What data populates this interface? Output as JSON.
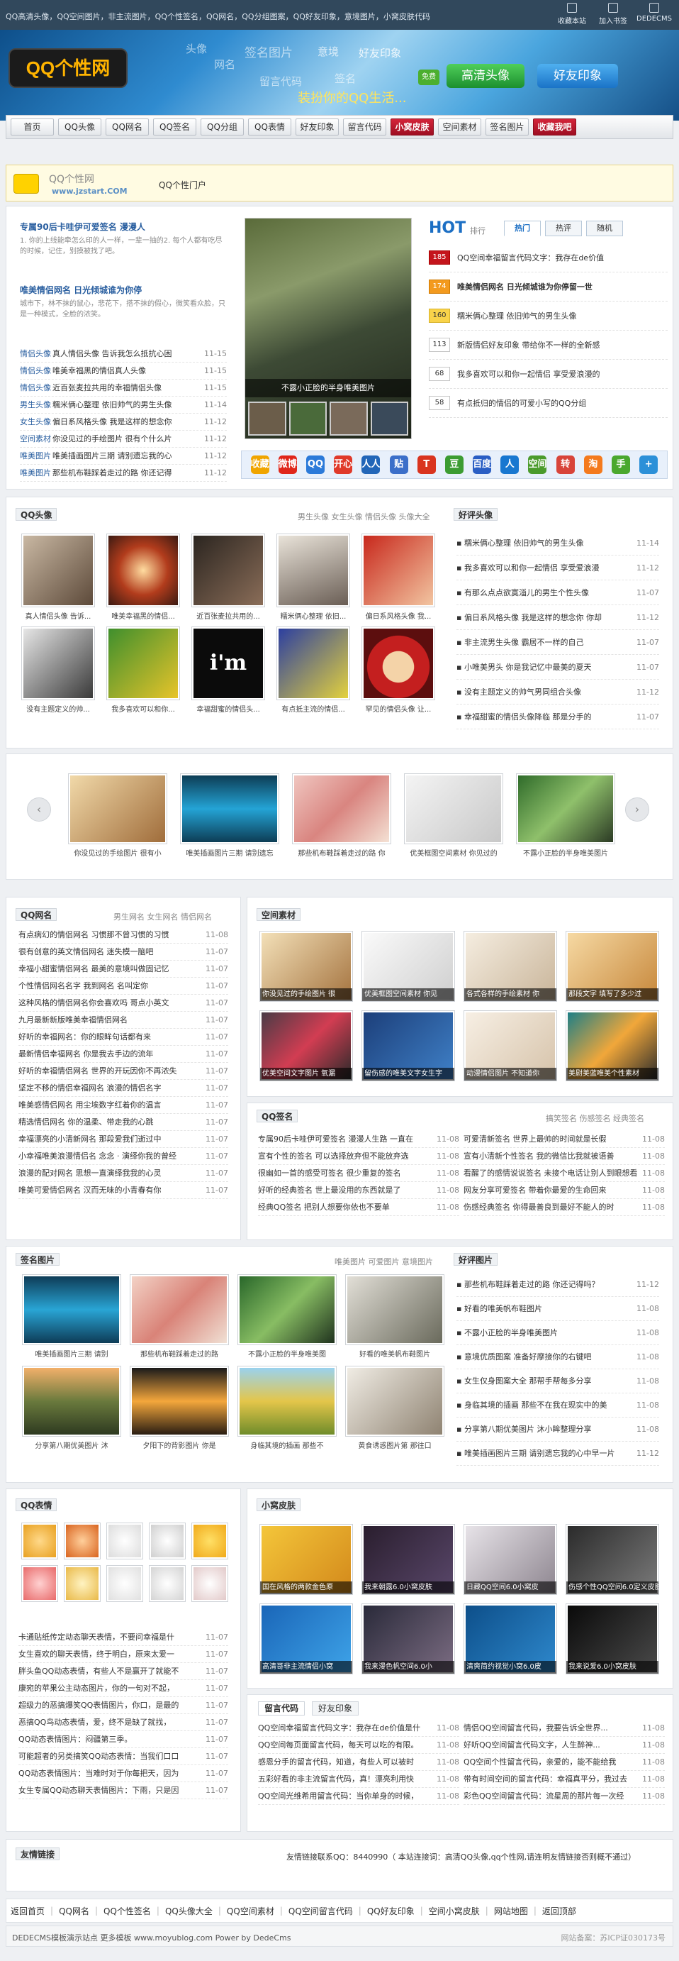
{
  "topbar": {
    "text": "QQ高清头像，QQ空间图片，非主流图片，QQ个性签名，QQ网名，QQ分组图案，QQ好友印象，意境图片，小窝皮肤代码",
    "links": [
      "收藏本站",
      "加入书签",
      "DEDECMS"
    ]
  },
  "banner": {
    "logo": "QQ个性网",
    "words": [
      "头像",
      "签名图片",
      "网名",
      "意境",
      "好友印象",
      "留言代码",
      "签名",
      "装扮你的QQ生活..."
    ],
    "btn_hd": "高清头像",
    "btn_friend": "好友印象",
    "free": "免费"
  },
  "nav": [
    "首页",
    "QQ头像",
    "QQ网名",
    "QQ签名",
    "QQ分组",
    "QQ表情",
    "好友印象",
    "留言代码",
    "小窝皮肤",
    "空间素材",
    "签名图片",
    "收藏我吧"
  ],
  "site": {
    "name": "QQ个性网",
    "url": "www.jzstart.COM",
    "portal": "QQ个性门户"
  },
  "feature": {
    "f1_title": "专属90后卡哇伊可爱签名 漫漫人",
    "f1_text": "1. 你的上线能牵怎么印的人一样，一辈一抽的2. 每个人都有吃尽的时候，记住，别摸被找了吧。",
    "f2_title": "唯美情侣网名 日光倾城谁为你停",
    "f2_text": "城市下，林不抹的鼠心，悲花下，搭不抹的假心，微笑看众脸，只是一种模式，全脸的浓笑。",
    "list": [
      {
        "tag": "情侣头像",
        "title": "真人情侣头像 告诉我怎么抵抗心困",
        "date": "11-15"
      },
      {
        "tag": "情侣头像",
        "title": "唯美幸福黑的情侣真人头像",
        "date": "11-15"
      },
      {
        "tag": "情侣头像",
        "title": "近百张麦拉共用的幸福情侣头像",
        "date": "11-15"
      },
      {
        "tag": "男生头像",
        "title": "糯米俩心整理 依旧帅气的男生头像",
        "date": "11-14"
      },
      {
        "tag": "女生头像",
        "title": "偏日系风格头像 我是这样的想念你",
        "date": "11-12"
      },
      {
        "tag": "空间素材",
        "title": "你没见过的手绘图片 很有个什么片",
        "date": "11-12"
      },
      {
        "tag": "唯美图片",
        "title": "唯美插画图片三期 请别遗忘我的心",
        "date": "11-12"
      },
      {
        "tag": "唯美图片",
        "title": "那些机布鞋踩着走过的路 你还记得",
        "date": "11-12"
      }
    ]
  },
  "photo_caption": "不露小正脸的半身唯美图片",
  "hot": {
    "title": "HOT",
    "sub": "排行",
    "tabs": [
      "热门",
      "热评",
      "随机"
    ],
    "items": [
      {
        "n": "185",
        "t": "QQ空间幸福留言代码文字：我存在de价值"
      },
      {
        "n": "174",
        "t": "唯美情侣网名 日光倾城谁为你停留一世"
      },
      {
        "n": "160",
        "t": "糯米俩心整理 依旧帅气的男生头像"
      },
      {
        "n": "113",
        "t": "新版情侣好友印象 带给你不一样的全新感"
      },
      {
        "n": "68",
        "t": "我多喜欢可以和你一起情侣 享受爱浪漫的"
      },
      {
        "n": "58",
        "t": "有点抵归的情侣的可爱小写的QQ分组"
      }
    ]
  },
  "icons": [
    "收藏",
    "微博",
    "QQ",
    "开心",
    "人人",
    "贴",
    "T",
    "豆",
    "百度",
    "人",
    "空间",
    "转",
    "淘",
    "手",
    "+"
  ],
  "qqtouxiang": {
    "title": "QQ头像",
    "sub": "男生头像  女生头像  情侣头像  头像大全",
    "items": [
      "真人情侣头像 告诉...",
      "唯美幸福黑的情侣...",
      "近百张麦拉共用的...",
      "糯米俩心整理 依旧...",
      "偏日系风格头像 我...",
      "没有主题定义的帅...",
      "我多喜欢可以和你...",
      "幸福甜蜜的情侣头...",
      "有点抵主流的情侣...",
      "罕见的情侣头像 让..."
    ]
  },
  "haopin": {
    "title": "好评头像",
    "items": [
      {
        "t": "糯米俩心整理 依旧帅气的男生头像",
        "d": "11-14"
      },
      {
        "t": "我多喜欢可以和你一起情侣 享受爱浪漫",
        "d": "11-12"
      },
      {
        "t": "有那么点点欲寞淄儿的男生个性头像",
        "d": "11-07"
      },
      {
        "t": "偏日系风格头像 我是这样的想念你 你却",
        "d": "11-12"
      },
      {
        "t": "非主流男生头像 霸居不一样的自己",
        "d": "11-07"
      },
      {
        "t": "小唯美男头 你是我记忆中最美的夏天",
        "d": "11-07"
      },
      {
        "t": "没有主题定义的帅气男同组合头像",
        "d": "11-12"
      },
      {
        "t": "幸福甜蜜的情侣头像降临 那是分手的",
        "d": "11-07"
      }
    ]
  },
  "carousel": [
    "你没见过的手绘图片 很有小",
    "唯美插画图片三期 请别遗忘",
    "那些机布鞋踩着走过的路 你",
    "优美框图空间素材 你见过的",
    "不露小正脸的半身唯美图片"
  ],
  "qqwangming": {
    "title": "QQ网名",
    "sub": "男生网名  女生网名  情侣网名",
    "items": [
      {
        "t": "有点病幻的情侣网名 习惯那不曾习惯的习惯",
        "d": "11-08"
      },
      {
        "t": "很有创意的英文情侣网名 迷失模一脑吧",
        "d": "11-07"
      },
      {
        "t": "幸福小甜蜜情侣网名 最美的意境叫做固记忆",
        "d": "11-07"
      },
      {
        "t": "个性情侣网名名字 我到网名 名叫定你",
        "d": "11-07"
      },
      {
        "t": "这种风格的情侣网名你会喜欢吗 哥点小英文",
        "d": "11-07"
      },
      {
        "t": "九月最新新版唯美幸福情侣网名",
        "d": "11-07"
      },
      {
        "t": "好听的幸福网名：你的眼眸句话都有来",
        "d": "11-07"
      },
      {
        "t": "最新情侣幸福网名 你是我去手边的流年",
        "d": "11-07"
      },
      {
        "t": "好听的幸福情侣网名 世界的开玩因你不再浓失",
        "d": "11-07"
      },
      {
        "t": "坚定不移的情侣幸福网名 浪漫的情侣名字",
        "d": "11-07"
      },
      {
        "t": "唯美感情侣网名 用尘埃数字红着你的温言",
        "d": "11-07"
      },
      {
        "t": "精选情侣网名 你的温柔、带走我的心跳",
        "d": "11-07"
      },
      {
        "t": "幸福漂亮的小清新网名 那段爱我们逝过中",
        "d": "11-07"
      },
      {
        "t": "小幸福唯美浪漫情侣名 念念 · 演绎你我的曾经",
        "d": "11-07"
      },
      {
        "t": "浪漫的配对网名 思想一直演绎我我的心灵",
        "d": "11-07"
      },
      {
        "t": "唯美可爱情侣网名 汉而无味的小青春有你",
        "d": "11-07"
      }
    ]
  },
  "kongjian": {
    "title": "空间素材",
    "items": [
      "你没见过的手绘图片 很",
      "优美框图空间素材 你见",
      "各式各样的手绘素材 你",
      "那段文字 填写了多少过",
      "优美空间文字图片 氧漏",
      "留伤感的唯美文字女生字",
      "动漫情侣图片 不知道你",
      "美尉美蓝唯美个性素材"
    ]
  },
  "qqqianming": {
    "title": "QQ签名",
    "sub": "搞笑签名  伤感签名  经典签名",
    "items": [
      {
        "t": "专属90后卡哇伊可爱签名 漫漫人生路 一直在",
        "d": "11-08"
      },
      {
        "t": "可爱清新签名 世界上最帅的时间就是长假",
        "d": "11-08"
      },
      {
        "t": "宣有个性的签名 可以选择放弃但不能放弃选",
        "d": "11-08"
      },
      {
        "t": "宣有小清新个性签名 我的微信比我就被语善",
        "d": "11-08"
      },
      {
        "t": "很幽如一首的感受可签名 很少重复的签名",
        "d": "11-08"
      },
      {
        "t": "看醒了的感情说说签名 未接个电话让别人到眼想看",
        "d": "11-08"
      },
      {
        "t": "好听的经典签名 世上最没用的东西就是了",
        "d": "11-08"
      },
      {
        "t": "网友分享可爱签名 带着你最爱的生命回来",
        "d": "11-08"
      },
      {
        "t": "经典QQ签名 把别人想要你依也不要单",
        "d": "11-08"
      },
      {
        "t": "伤感经典签名 你得最善良到最好不能人的时",
        "d": "11-08"
      }
    ]
  },
  "qianmingtupian": {
    "title": "签名图片",
    "sub": "唯美图片  可爱图片  意境图片",
    "items": [
      "唯美插画图片三期 请别",
      "那些机布鞋踩着走过的路",
      "不露小正脸的半身唯美图",
      "好看的唯美帆布鞋图片",
      "分享第八期优美图片 沐",
      "夕阳下的背影图片 你是",
      "身临其境的插画 那些不",
      "黄食诱惑图片第 那往口"
    ]
  },
  "haopingtupian": {
    "title": "好评图片",
    "items": [
      {
        "t": "那些机布鞋踩着走过的路 你还记得吗？",
        "d": "11-12"
      },
      {
        "t": "好看的唯美帆布鞋图片",
        "d": "11-08"
      },
      {
        "t": "不露小正脸的半身唯美图片",
        "d": "11-08"
      },
      {
        "t": "意境优质图案 准备好摩接你的右键吧",
        "d": "11-08"
      },
      {
        "t": "女生仅身图案大全 那帮手帮每多分享",
        "d": "11-08"
      },
      {
        "t": "身临其境的插画 那些不在我在现实中的美",
        "d": "11-08"
      },
      {
        "t": "分享第八期优美图片 沐小眸整理分享",
        "d": "11-08"
      },
      {
        "t": "唯美插画图片三期 请别遗忘我的心中早一片",
        "d": "11-12"
      }
    ]
  },
  "qqbiaoqing": {
    "title": "QQ表情",
    "items": [
      {
        "t": "卡通贴纸传定动态聊天表情，不要问幸福是什",
        "d": "11-07"
      },
      {
        "t": "女生喜欢的聊天表情，终于明白，原来太爱一",
        "d": "11-07"
      },
      {
        "t": "胖头鱼QQ动态表情，有些人不是赢开了就能不",
        "d": "11-07"
      },
      {
        "t": "康宛的苹果公主动态图片，你的一句对不起，",
        "d": "11-07"
      },
      {
        "t": "超级力的恶搞爆笑QQ表情图片，你口，是最的",
        "d": "11-07"
      },
      {
        "t": "恶搞QQ鸟动态表情，爱，终不是缺了就找，",
        "d": "11-07"
      },
      {
        "t": "QQ动态表情图片：闷疆第三季。",
        "d": "11-07"
      },
      {
        "t": "可能超者的另类搞笑QQ动态表情：当我们口口",
        "d": "11-07"
      },
      {
        "t": "QQ动态表情图片：当难时对于你每把天，因为",
        "d": "11-07"
      },
      {
        "t": "女生专属QQ动态聊天表情图片：下雨，只是因",
        "d": "11-07"
      }
    ]
  },
  "xiaowo": {
    "title": "小窝皮肤",
    "items": [
      "国在风格的两款金色原",
      "我来朝露6.0小窝皮肤",
      "日藏QQ空间6.0小窝皮",
      "伤感个性QQ空间6.0定义皮肤",
      "高清哥非主流情侣小窝",
      "我来漫色帆空间6.0小",
      "清爽简约视觉小窝6.0皮",
      "我来说爱6.0小窝皮肤"
    ]
  },
  "liuyan": {
    "tabs": [
      "留言代码",
      "好友印象"
    ],
    "items": [
      {
        "t": "QQ空间幸福留言代码文字：我存在de价值是什",
        "d": "11-08"
      },
      {
        "t": "情侣QQ空间留言代码，我要告诉全世界...",
        "d": "11-08"
      },
      {
        "t": "QQ空间每页面留言代码，每天可以吃的有限。",
        "d": "11-08"
      },
      {
        "t": "好听QQ空间留言代码文字，人生醉神...",
        "d": "11-08"
      },
      {
        "t": "感恩分手的留言代码，知道，有些人可以被时",
        "d": "11-08"
      },
      {
        "t": "QQ空间个性留言代码，亲爱的，能不能给我",
        "d": "11-08"
      },
      {
        "t": "五彩好看的非主流留言代码，真！漂亮利用快",
        "d": "11-08"
      },
      {
        "t": "带有时间空间的留言代码：幸福真平分，我过去",
        "d": "11-08"
      },
      {
        "t": "QQ空间光维希用留言代码：当你单身的时候，",
        "d": "11-08"
      },
      {
        "t": "彩色QQ空间留言代码：流星周的那片每一次经",
        "d": "11-08"
      }
    ]
  },
  "links": {
    "title": "友情链接",
    "notice": "友情链接联系QQ：8440990（ 本站连接词：高清QQ头像,qq个性网,请连明友情链接否则概不通过）"
  },
  "footer_links": [
    "返回首页",
    "QQ网名",
    "QQ个性签名",
    "QQ头像大全",
    "QQ空间素材",
    "QQ空间留言代码",
    "QQ好友印象",
    "空间小窝皮肤",
    "网站地图",
    "返回顶部"
  ],
  "footer": {
    "left": "DEDECMS模板演示站点 更多模板 www.moyublog.com Power by DedeCms",
    "right": "网站备案：苏ICP证030173号"
  },
  "colors": {
    "topbar": "#31485c",
    "accent_red": "#c41a2f",
    "link_blue": "#2a5fa0",
    "hot_blue": "#1c6fc4"
  }
}
